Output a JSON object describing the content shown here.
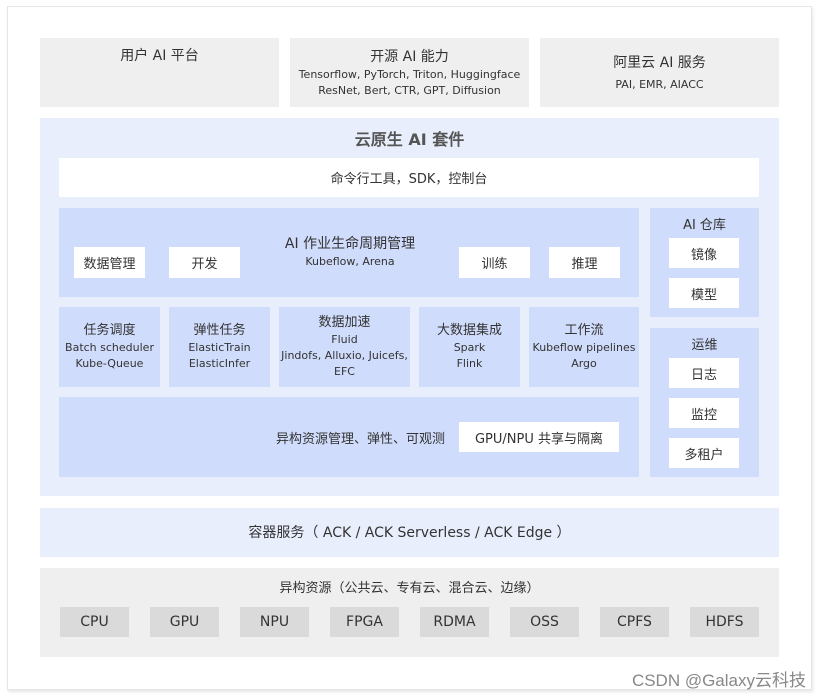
{
  "top_row": [
    {
      "title": "用户 AI 平台",
      "lines": []
    },
    {
      "title": "开源 AI 能力",
      "lines": [
        "Tensorflow, PyTorch, Triton, Huggingface",
        "ResNet, Bert, CTR, GPT, Diffusion"
      ]
    },
    {
      "title": "阿里云 AI 服务",
      "lines": [
        "PAI, EMR, AIACC"
      ]
    }
  ],
  "suite": {
    "title": "云原生 AI 套件",
    "cli_bar": "命令行工具，SDK，控制台",
    "lifecycle": {
      "title": "AI 作业生命周期管理",
      "subtitle": "Kubeflow, Arena",
      "left_items": [
        "数据管理",
        "开发"
      ],
      "right_items": [
        "训练",
        "推理"
      ]
    },
    "modules": [
      {
        "title": "任务调度",
        "lines": [
          "Batch scheduler",
          "Kube-Queue"
        ]
      },
      {
        "title": "弹性任务",
        "lines": [
          "ElasticTrain",
          "ElasticInfer"
        ]
      },
      {
        "title": "数据加速",
        "lines": [
          "Fluid",
          "Jindofs, Alluxio, Juicefs,",
          "EFC"
        ]
      },
      {
        "title": "大数据集成",
        "lines": [
          "Spark",
          "Flink"
        ]
      },
      {
        "title": "工作流",
        "lines": [
          "Kubeflow pipelines",
          "Argo"
        ]
      }
    ],
    "hetero_mgmt": {
      "label": "异构资源管理、弹性、可观测",
      "chip": "GPU/NPU 共享与隔离"
    },
    "ai_repo": {
      "title": "AI 仓库",
      "items": [
        "镜像",
        "模型"
      ]
    },
    "ops": {
      "title": "运维",
      "items": [
        "日志",
        "监控",
        "多租户"
      ]
    }
  },
  "container_service": "容器服务（ ACK / ACK Serverless / ACK Edge ）",
  "resources": {
    "title": "异构资源（公共云、专有云、混合云、边缘）",
    "items": [
      "CPU",
      "GPU",
      "NPU",
      "FPGA",
      "RDMA",
      "OSS",
      "CPFS",
      "HDFS"
    ]
  },
  "watermark": "CSDN @Galaxy云科技",
  "colors": {
    "gray_panel": "#efefef",
    "suite_bg": "#e8eefc",
    "module_bg": "#d0dcfb",
    "chip_gray": "#dadada",
    "white": "#ffffff"
  }
}
